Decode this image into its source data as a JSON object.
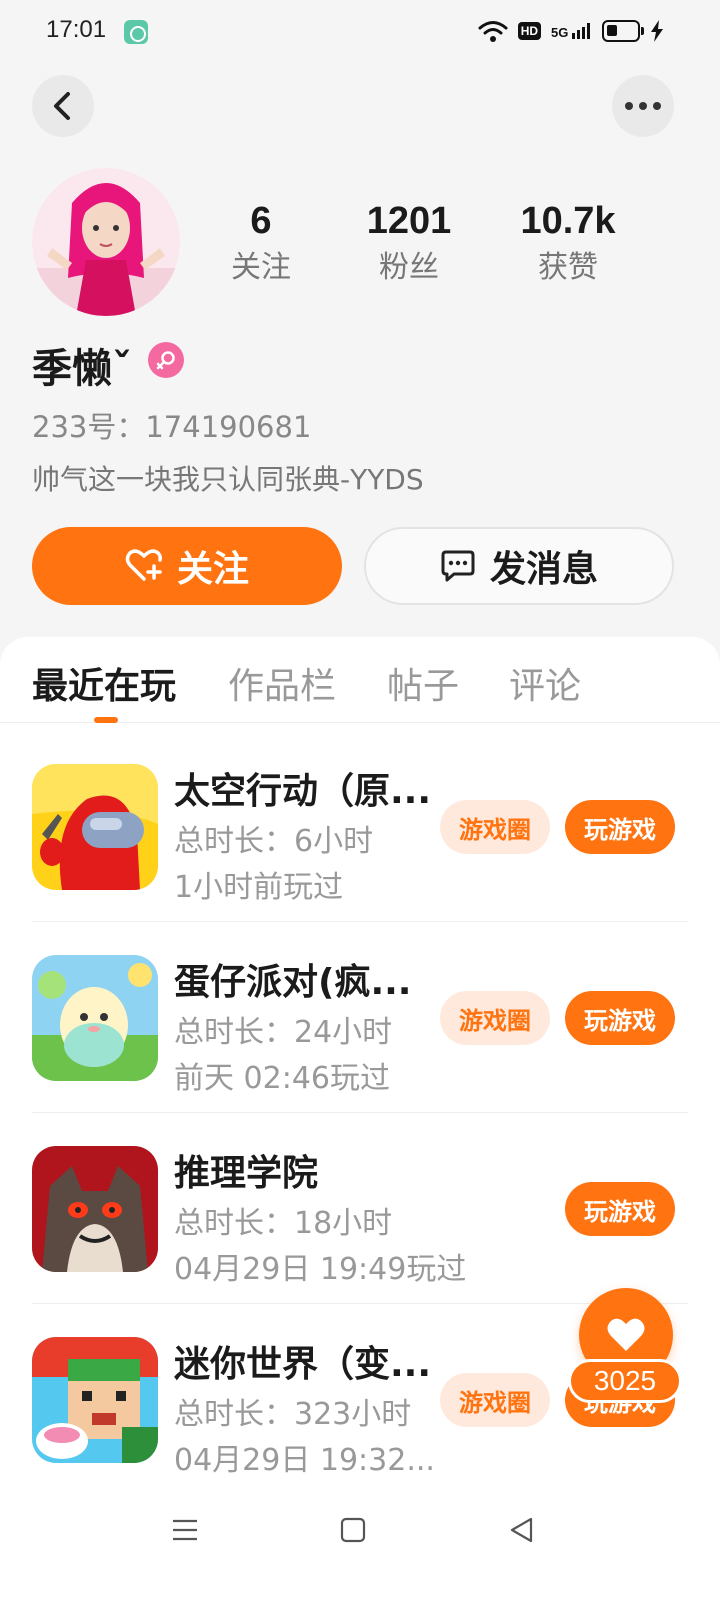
{
  "status_bar": {
    "time": "17:01",
    "hd": "HD",
    "network": "5G"
  },
  "profile": {
    "stats": [
      {
        "value": "6",
        "label": "关注"
      },
      {
        "value": "1201",
        "label": "粉丝"
      },
      {
        "value": "10.7k",
        "label": "获赞"
      }
    ],
    "username": "季懒ˇ",
    "uid": "233号：174190681",
    "bio": "帅气这一块我只认同张典-YYDS",
    "follow_label": "关注",
    "message_label": "发消息"
  },
  "tabs": [
    {
      "label": "最近在玩",
      "active": true
    },
    {
      "label": "作品栏",
      "active": false
    },
    {
      "label": "帖子",
      "active": false
    },
    {
      "label": "评论",
      "active": false
    }
  ],
  "games": [
    {
      "title": "太空行动（原...",
      "duration": "总时长：6小时",
      "last_played": "1小时前玩过",
      "circle_label": "游戏圈",
      "play_label": "玩游戏"
    },
    {
      "title": "蛋仔派对(疯...",
      "duration": "总时长：24小时",
      "last_played": "前天 02:46玩过",
      "circle_label": "游戏圈",
      "play_label": "玩游戏"
    },
    {
      "title": "推理学院",
      "duration": "总时长：18小时",
      "last_played": "04月29日 19:49玩过",
      "circle_label": "",
      "play_label": "玩游戏"
    },
    {
      "title": "迷你世界（变...",
      "duration": "总时长：323小时",
      "last_played": "04月29日 19:32...",
      "circle_label": "游戏圈",
      "play_label": "玩游戏"
    }
  ],
  "like": {
    "count": "3025"
  },
  "colors": {
    "accent": "#ff7310",
    "accent_light": "#ffe9dc"
  },
  "icons": [
    "back-icon",
    "more-icon",
    "heart-plus-icon",
    "chat-icon",
    "female-icon",
    "heart-icon",
    "menu-icon",
    "home-icon",
    "back-triangle-icon"
  ]
}
